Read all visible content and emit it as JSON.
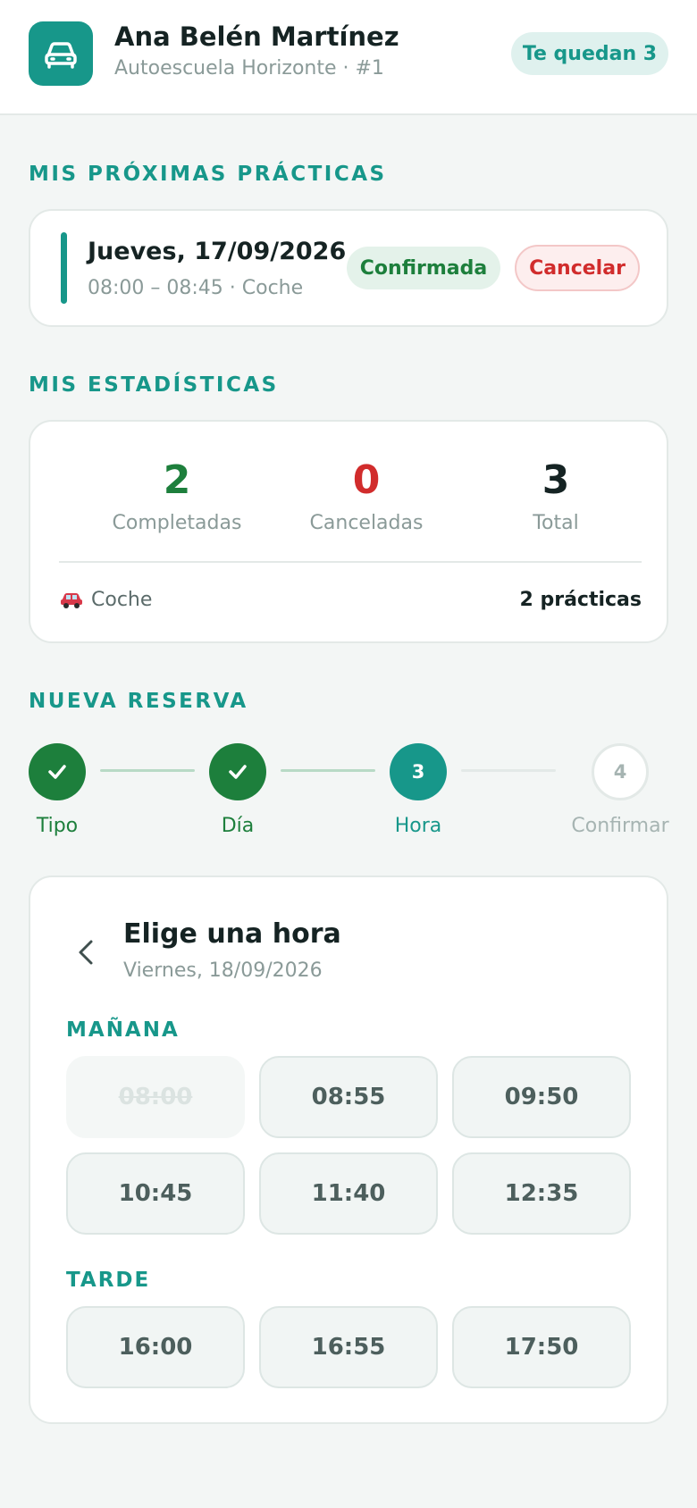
{
  "header": {
    "user_name": "Ana Belén Martínez",
    "subtitle": "Autoescuela Horizonte · #1",
    "remaining_badge": "Te quedan 3"
  },
  "upcoming": {
    "section_title": "MIS PRÓXIMAS PRÁCTICAS",
    "date": "Jueves, 17/09/2026",
    "details": "08:00 – 08:45 · Coche",
    "status": "Confirmada",
    "cancel_label": "Cancelar"
  },
  "stats": {
    "section_title": "MIS ESTADÍSTICAS",
    "completed": {
      "value": "2",
      "label": "Completadas"
    },
    "cancelled": {
      "value": "0",
      "label": "Canceladas"
    },
    "total": {
      "value": "3",
      "label": "Total"
    },
    "vehicle": {
      "label": "Coche",
      "count": "2 prácticas"
    }
  },
  "booking": {
    "section_title": "NUEVA RESERVA",
    "steps": [
      {
        "label": "Tipo",
        "state": "done"
      },
      {
        "label": "Día",
        "state": "done"
      },
      {
        "label": "Hora",
        "number": "3",
        "state": "active"
      },
      {
        "label": "Confirmar",
        "number": "4",
        "state": "pending"
      }
    ],
    "time_card": {
      "title": "Elige una hora",
      "date": "Viernes, 18/09/2026",
      "morning_title": "MAÑANA",
      "morning_slots": [
        "08:00",
        "08:55",
        "09:50",
        "10:45",
        "11:40",
        "12:35"
      ],
      "afternoon_title": "TARDE",
      "afternoon_slots": [
        "16:00",
        "16:55",
        "17:50"
      ]
    }
  },
  "colors": {
    "accent": "#17978a",
    "success": "#1d7f3c",
    "danger": "#d12c2c",
    "background": "#f3f6f5"
  }
}
